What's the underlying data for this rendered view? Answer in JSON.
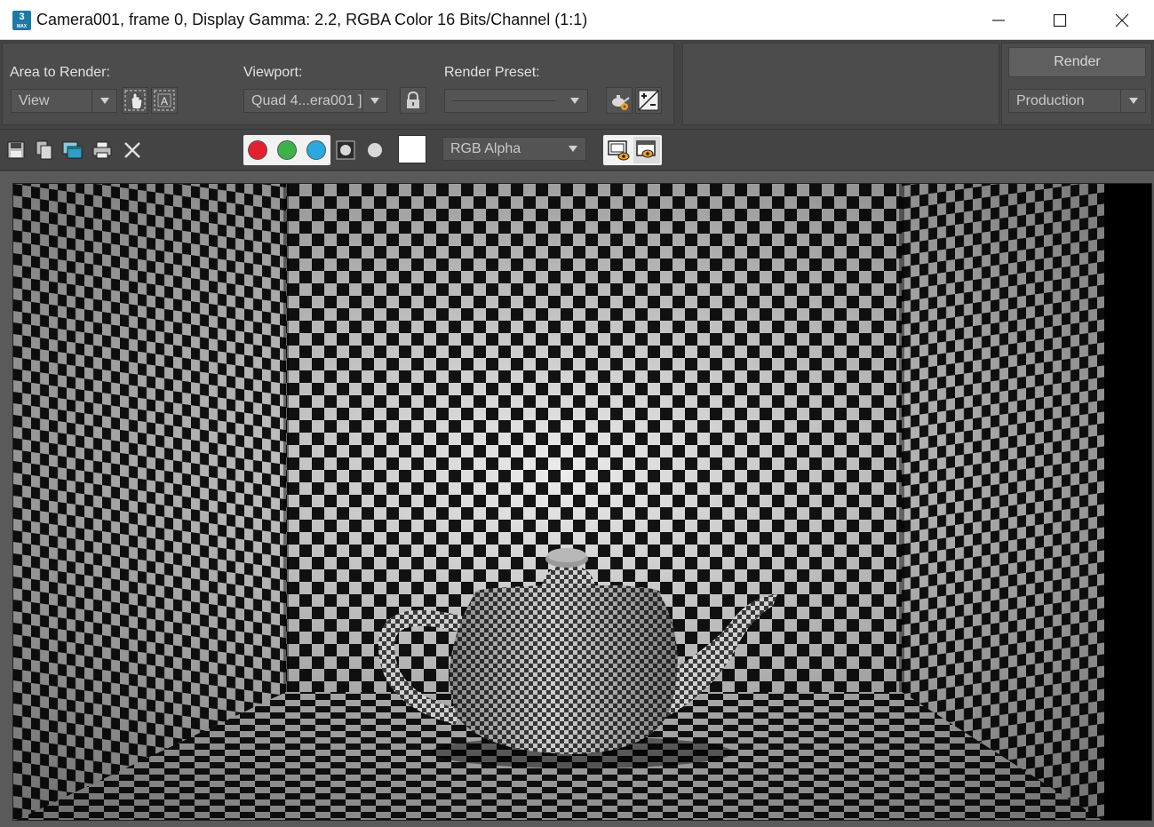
{
  "window": {
    "title": "Camera001, frame 0, Display Gamma: 2.2, RGBA Color 16 Bits/Channel (1:1)",
    "app_icon_text": "3",
    "app_icon_subtext": "MAX"
  },
  "top_panel": {
    "area_to_render": {
      "label": "Area to Render:",
      "value": "View"
    },
    "viewport": {
      "label": "Viewport:",
      "value": "Quad 4...era001 ]"
    },
    "render_preset": {
      "label": "Render Preset:",
      "value": ""
    },
    "render_button": "Render",
    "production": {
      "value": "Production"
    }
  },
  "toolbar": {
    "channel_display": {
      "value": "RGB Alpha"
    },
    "channels": [
      {
        "name": "red",
        "color": "#e5202e"
      },
      {
        "name": "green",
        "color": "#3db24a"
      },
      {
        "name": "blue",
        "color": "#2aa8e0"
      }
    ]
  },
  "colors": {
    "panel_bg": "#444444",
    "section_bg": "#4c4c4c",
    "accent_orange": "#f0a020"
  },
  "render_image": {
    "description_icon": "checker-teapot-render"
  }
}
